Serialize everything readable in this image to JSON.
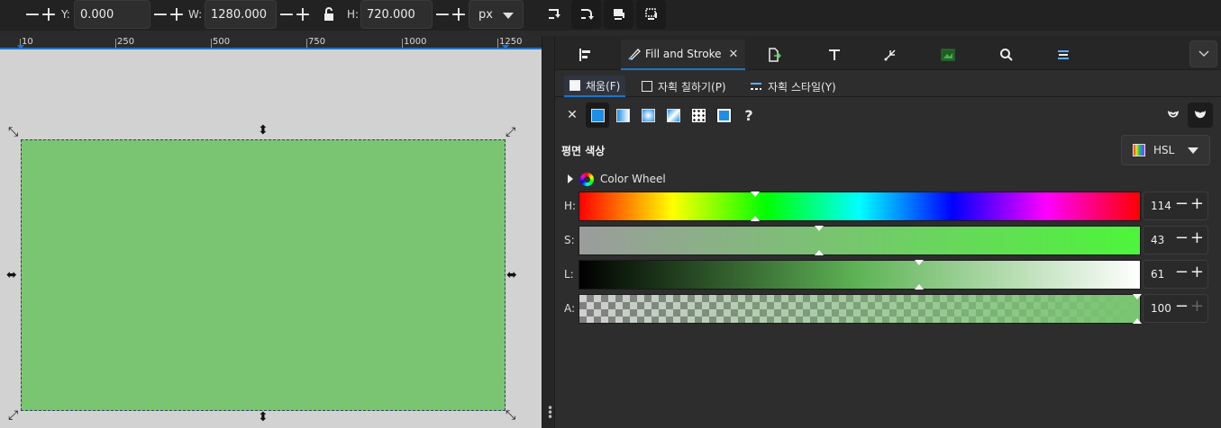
{
  "toolbar": {
    "y_label": "Y:",
    "y_value": "0.000",
    "w_label": "W:",
    "w_value": "1280.000",
    "h_label": "H:",
    "h_value": "720.000",
    "unit": "px",
    "minus": "−",
    "plus": "+"
  },
  "ruler": {
    "labels": [
      "10",
      "250",
      "500",
      "750",
      "1000",
      "1250"
    ]
  },
  "panel": {
    "tabs": {
      "fill_stroke_label": "Fill and Stroke",
      "close_glyph": "✕"
    },
    "subtabs": {
      "fill": "채움(F)",
      "stroke_paint": "자획 칠하기(P)",
      "stroke_style": "자획 스타일(Y)"
    },
    "paint": {
      "none_glyph": "✕",
      "unset_glyph": "?"
    },
    "flat_color_title": "평면 색상",
    "color_mode": "HSL",
    "color_wheel_label": "Color Wheel",
    "sliders": {
      "h": {
        "label": "H:",
        "value": "114"
      },
      "s": {
        "label": "S:",
        "value": "43"
      },
      "l": {
        "label": "L:",
        "value": "61"
      },
      "a": {
        "label": "A:",
        "value": "100"
      }
    }
  },
  "colors": {
    "object_fill": "#79c571",
    "accent": "#1f74c6"
  }
}
